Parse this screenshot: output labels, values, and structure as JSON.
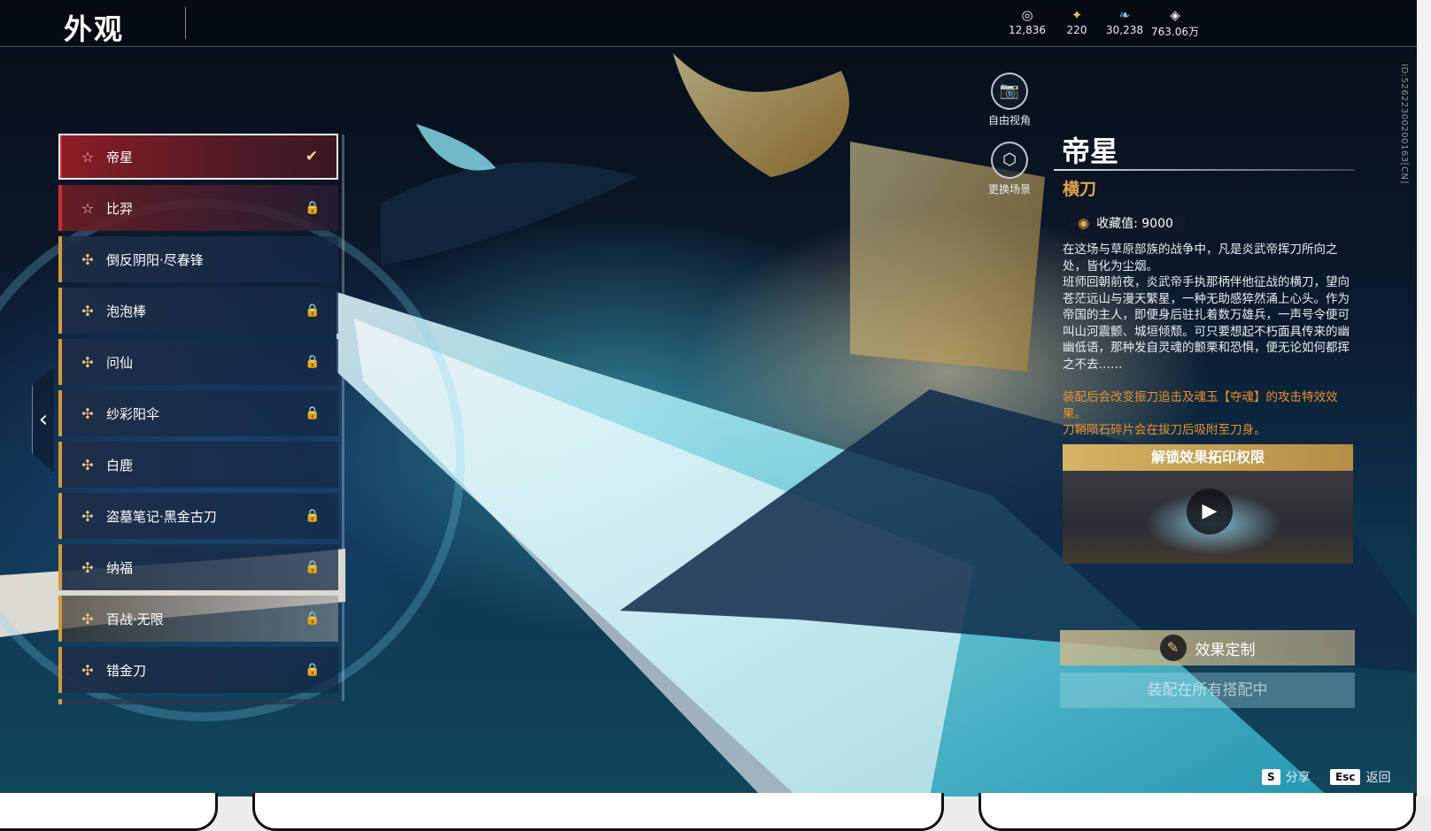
{
  "header": {
    "title": "外观"
  },
  "currencies": [
    {
      "icon": "coin-stack-icon",
      "glyph": "◎",
      "value": "12,836"
    },
    {
      "icon": "ticket-icon",
      "glyph": "✦",
      "value": "220"
    },
    {
      "icon": "feather-icon",
      "glyph": "❧",
      "value": "30,238"
    },
    {
      "icon": "diamond-icon",
      "glyph": "◈",
      "value": "763.06万"
    }
  ],
  "id_label": "ID:52622300200163[CN]",
  "list": {
    "items": [
      {
        "name": "帝星",
        "icon": "☆",
        "tier": "red",
        "state": "✔",
        "state_icon": "check-icon",
        "selected": true
      },
      {
        "name": "比羿",
        "icon": "☆",
        "tier": "red",
        "state": "🔒",
        "state_icon": "lock-icon"
      },
      {
        "name": "倒反阴阳·尽春锋",
        "icon": "✣",
        "tier": "gold",
        "state": "",
        "state_icon": ""
      },
      {
        "name": "泡泡棒",
        "icon": "✣",
        "tier": "gold",
        "state": "🔒",
        "state_icon": "lock-icon"
      },
      {
        "name": "问仙",
        "icon": "✣",
        "tier": "gold",
        "state": "🔒",
        "state_icon": "lock-icon"
      },
      {
        "name": "纱彩阳伞",
        "icon": "✣",
        "tier": "gold",
        "state": "🔒",
        "state_icon": "lock-icon"
      },
      {
        "name": "白鹿",
        "icon": "✣",
        "tier": "gold",
        "state": "",
        "state_icon": ""
      },
      {
        "name": "盗墓笔记·黑金古刀",
        "icon": "✣",
        "tier": "gold",
        "state": "🔒",
        "state_icon": "lock-icon"
      },
      {
        "name": "纳福",
        "icon": "✣",
        "tier": "gold",
        "state": "🔒",
        "state_icon": "lock-icon"
      },
      {
        "name": "百战·无限",
        "icon": "✣",
        "tier": "gold",
        "state": "🔒",
        "state_icon": "lock-icon",
        "highlight": true
      },
      {
        "name": "错金刀",
        "icon": "✣",
        "tier": "gold",
        "state": "🔒",
        "state_icon": "lock-icon"
      }
    ]
  },
  "side_tab": {
    "glyph": "‹"
  },
  "tools": {
    "free_view": {
      "label": "自由视角",
      "glyph": "📷"
    },
    "change_scene": {
      "label": "更换场景",
      "glyph": "⬡"
    }
  },
  "detail": {
    "name": "帝星",
    "type": "横刀",
    "collect_label": "收藏值: 9000",
    "desc": [
      "在这场与草原部族的战争中，凡是炎武帝挥刀所向之处，皆化为尘烟。",
      "班师回朝前夜，炎武帝手执那柄伴他征战的横刀，望向苍茫远山与漫天繁星，一种无助感猝然涌上心头。作为帝国的主人，即便身后驻扎着数万雄兵，一声号令便可叫山河震颤、城垣倾颓。可只要想起不朽面具传来的幽幽低语，那种发自灵魂的颤栗和恐惧，便无论如何都挥之不去……"
    ],
    "effect": [
      "装配后会改变振刀追击及魂玉【夺魂】的攻击特效效果。",
      "刀鞘陨石碎片会在拔刀后吸附至刀身。"
    ],
    "unlock_title": "解锁效果拓印权限",
    "play_glyph": "▶",
    "custom_label": "效果定制",
    "custom_glyph": "✎",
    "equip_label": "装配在所有搭配中"
  },
  "hints": {
    "share_key": "S",
    "share_label": "分享",
    "back_key": "Esc",
    "back_label": "返回"
  },
  "colors": {
    "accent_gold": "#e3a64a",
    "selected_red": "#8b1d24",
    "effect_orange": "#e8922f"
  }
}
